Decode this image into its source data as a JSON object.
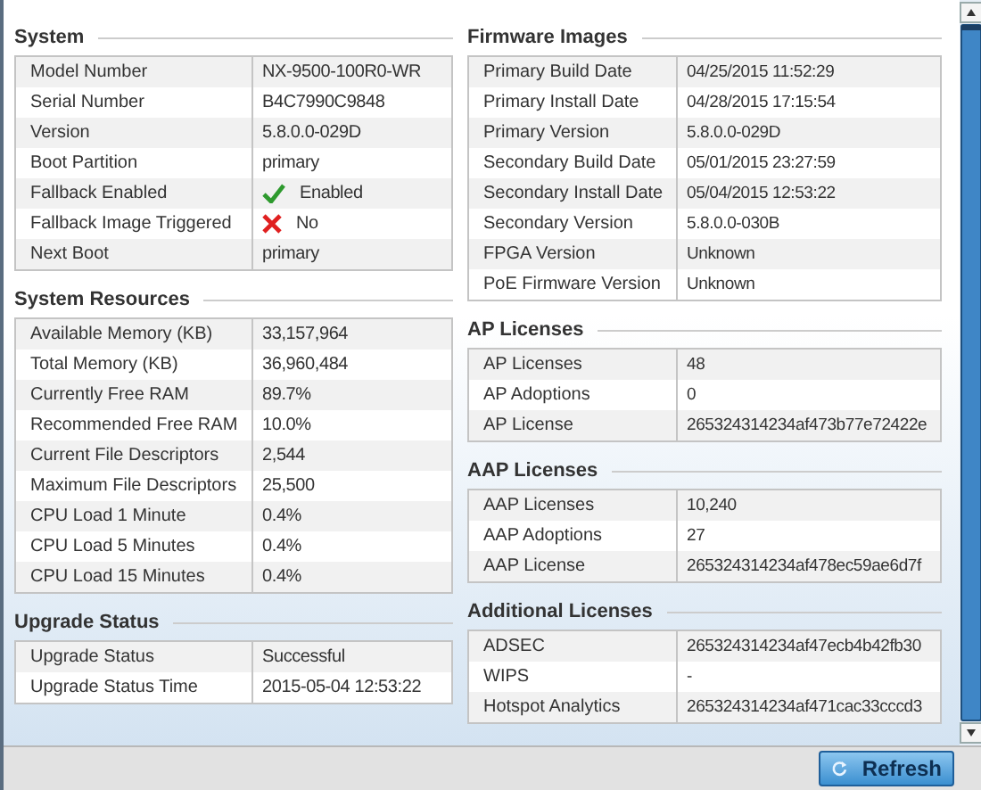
{
  "left": [
    {
      "title": "System",
      "rows": [
        {
          "label": "Model Number",
          "value": "NX-9500-100R0-WR",
          "kind": "text"
        },
        {
          "label": "Serial Number",
          "value": "B4C7990C9848",
          "kind": "text"
        },
        {
          "label": "Version",
          "value": "5.8.0.0-029D",
          "kind": "text"
        },
        {
          "label": "Boot Partition",
          "value": "primary",
          "kind": "text"
        },
        {
          "label": "Fallback Enabled",
          "value": "Enabled",
          "kind": "check"
        },
        {
          "label": "Fallback Image Triggered",
          "value": "No",
          "kind": "cross"
        },
        {
          "label": "Next Boot",
          "value": "primary",
          "kind": "text"
        }
      ]
    },
    {
      "title": "System Resources",
      "rows": [
        {
          "label": "Available Memory (KB)",
          "value": "33,157,964",
          "kind": "text"
        },
        {
          "label": "Total Memory (KB)",
          "value": "36,960,484",
          "kind": "text"
        },
        {
          "label": "Currently Free RAM",
          "value": "89.7%",
          "kind": "text"
        },
        {
          "label": "Recommended Free RAM",
          "value": "10.0%",
          "kind": "text"
        },
        {
          "label": "Current File Descriptors",
          "value": "2,544",
          "kind": "text"
        },
        {
          "label": "Maximum File Descriptors",
          "value": "25,500",
          "kind": "text"
        },
        {
          "label": "CPU Load 1 Minute",
          "value": "0.4%",
          "kind": "text"
        },
        {
          "label": "CPU Load 5 Minutes",
          "value": "0.4%",
          "kind": "text"
        },
        {
          "label": "CPU Load 15 Minutes",
          "value": "0.4%",
          "kind": "text"
        }
      ]
    },
    {
      "title": "Upgrade Status",
      "rows": [
        {
          "label": "Upgrade Status",
          "value": "Successful",
          "kind": "text"
        },
        {
          "label": "Upgrade Status Time",
          "value": "2015-05-04 12:53:22",
          "kind": "text"
        }
      ]
    }
  ],
  "right": [
    {
      "title": "Firmware Images",
      "rows": [
        {
          "label": "Primary Build Date",
          "value": "04/25/2015 11:52:29",
          "kind": "text"
        },
        {
          "label": "Primary Install Date",
          "value": "04/28/2015 17:15:54",
          "kind": "text"
        },
        {
          "label": "Primary Version",
          "value": "5.8.0.0-029D",
          "kind": "text"
        },
        {
          "label": "Secondary Build Date",
          "value": "05/01/2015 23:27:59",
          "kind": "text"
        },
        {
          "label": "Secondary Install Date",
          "value": "05/04/2015 12:53:22",
          "kind": "text"
        },
        {
          "label": "Secondary Version",
          "value": "5.8.0.0-030B",
          "kind": "text"
        },
        {
          "label": "FPGA Version",
          "value": "Unknown",
          "kind": "text"
        },
        {
          "label": "PoE Firmware Version",
          "value": "Unknown",
          "kind": "text"
        }
      ]
    },
    {
      "title": "AP Licenses",
      "rows": [
        {
          "label": "AP Licenses",
          "value": "48",
          "kind": "text"
        },
        {
          "label": "AP Adoptions",
          "value": "0",
          "kind": "text"
        },
        {
          "label": "AP License",
          "value": "265324314234af473b77e72422e",
          "kind": "text"
        }
      ]
    },
    {
      "title": "AAP Licenses",
      "rows": [
        {
          "label": "AAP Licenses",
          "value": "10,240",
          "kind": "text"
        },
        {
          "label": "AAP Adoptions",
          "value": "27",
          "kind": "text"
        },
        {
          "label": "AAP License",
          "value": "265324314234af478ec59ae6d7f",
          "kind": "text"
        }
      ]
    },
    {
      "title": "Additional Licenses",
      "rows": [
        {
          "label": "ADSEC",
          "value": "265324314234af47ecb4b42fb30",
          "kind": "text"
        },
        {
          "label": "WIPS",
          "value": "-",
          "kind": "text"
        },
        {
          "label": "Hotspot Analytics",
          "value": "265324314234af471cac33cccd3",
          "kind": "text"
        }
      ]
    }
  ],
  "refresh_button": "Refresh"
}
